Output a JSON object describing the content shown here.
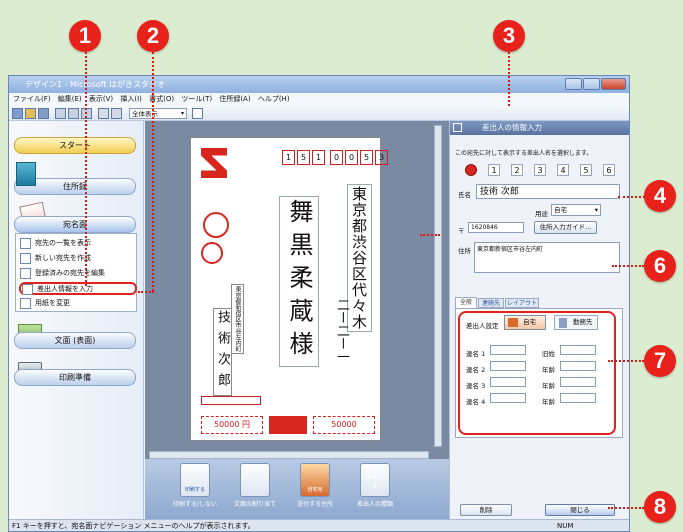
{
  "callouts": [
    "1",
    "2",
    "3",
    "4",
    "5",
    "6",
    "7",
    "8"
  ],
  "window": {
    "title": "デザイン1 - Microsoft はがきスタジオ",
    "menu": [
      "ファイル(F)",
      "編集(E)",
      "表示(V)",
      "挿入(I)",
      "書式(O)",
      "ツール(T)",
      "住所録(A)",
      "ヘルプ(H)"
    ],
    "zoom": "全体表示"
  },
  "nav": {
    "start": "スタート",
    "address_book": "住所録",
    "recipient_side": "宛名面",
    "items": [
      "宛先の一覧を表示",
      "新しい宛先を作成",
      "登録済みの宛先を編集",
      "差出人情報を入力",
      "用紙を変更"
    ],
    "front": "文面 (表面)",
    "print": "印刷準備"
  },
  "card": {
    "zip": [
      "1",
      "5",
      "1",
      "0",
      "0",
      "5",
      "3"
    ],
    "address_line1": "東京都渋谷区代々木",
    "address_line2": "二ー二ー一",
    "recipient": "舞黒柔蔵様",
    "sender_name": "技術次郎",
    "sender_address": "東京都新宿区市谷左内町",
    "stamp_left": "50000 円",
    "stamp_right": "50000"
  },
  "bottom_bar": [
    "印刷する/しない",
    "文面の割り当て",
    "送付する住所",
    "差出人の種類"
  ],
  "bottom_icon_text": {
    "print": "印刷する",
    "home": "自宅宛",
    "sender": "差出人",
    "sender_num": "1"
  },
  "panel": {
    "title": "差出人の情報入力",
    "instruction": "この宛先に対して表示する差出人名を選択します。",
    "numbers": [
      "1",
      "2",
      "3",
      "4",
      "5",
      "6"
    ],
    "name_label": "氏名",
    "name_value": "技術 次郎",
    "use_label": "用途",
    "use_value": "自宅",
    "zip_label": "〒",
    "zip_value": "1620846",
    "zip_button": "住所入力ガイド...",
    "address_label": "住所",
    "address_value": "東京都新宿区市谷左内町",
    "tabs": [
      "全般",
      "連絡先",
      "レイアウト"
    ],
    "sender_setting_label": "差出人設定",
    "home_option": "自宅",
    "work_option": "勤務先",
    "joint_labels": [
      "連名 1",
      "連名 2",
      "連名 3",
      "連名 4"
    ],
    "maiden_label": "旧姓",
    "age_label": "年齢",
    "delete_button": "削除",
    "close_button": "閉じる"
  },
  "status": {
    "text": "F1 キーを押すと、宛名面ナビゲーション メニューのヘルプが表示されます。",
    "num": "NUM"
  }
}
